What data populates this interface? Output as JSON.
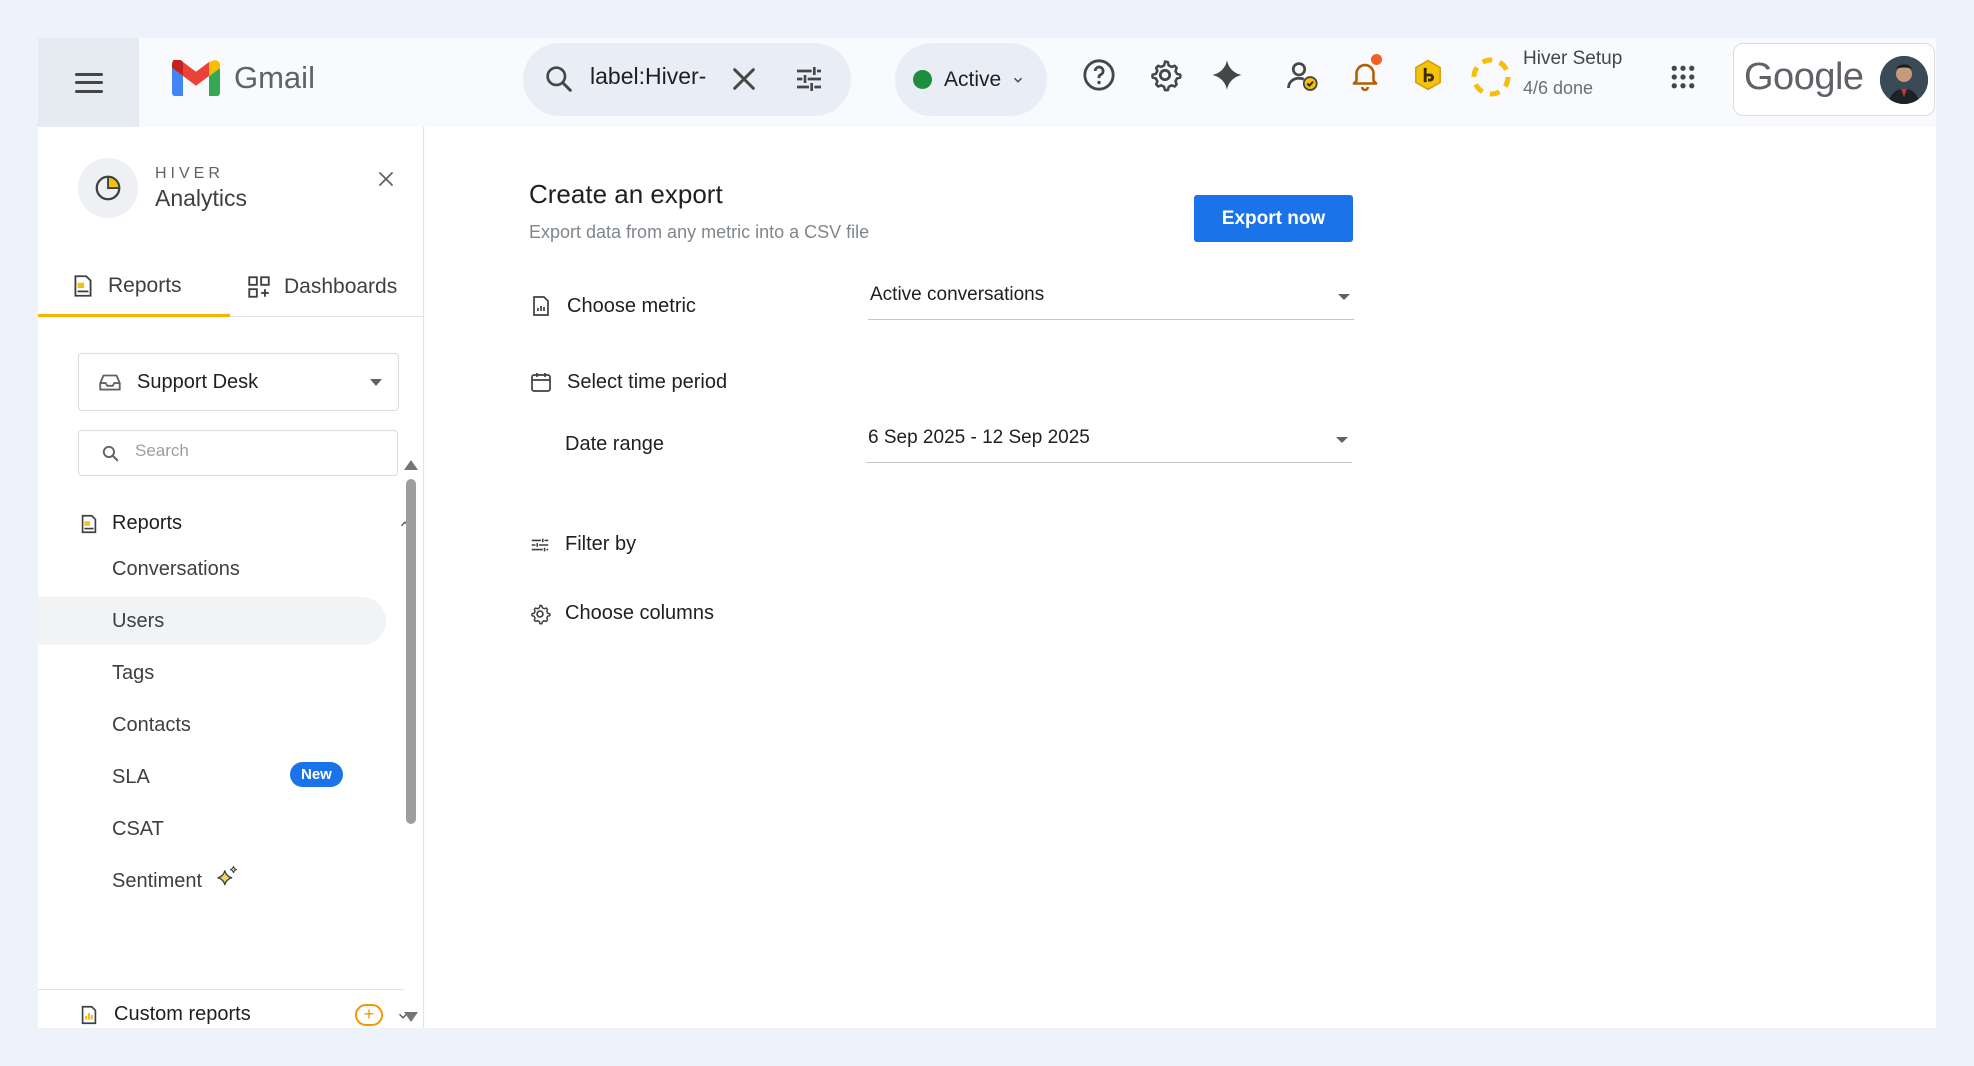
{
  "app": {
    "logo_text": "Gmail"
  },
  "search": {
    "query": "label:Hiver-"
  },
  "status": {
    "label": "Active",
    "color": "#1e8e3e"
  },
  "setup": {
    "title": "Hiver Setup",
    "progress": "4/6 done"
  },
  "account": {
    "brand": "Google"
  },
  "sidebar": {
    "brand": "HIVER",
    "title": "Analytics",
    "tabs": [
      {
        "label": "Reports",
        "active": true
      },
      {
        "label": "Dashboards",
        "active": false
      }
    ],
    "inbox_select": "Support Desk",
    "search_placeholder": "Search",
    "section_title": "Reports",
    "items": [
      {
        "label": "Conversations"
      },
      {
        "label": "Users",
        "selected": true
      },
      {
        "label": "Tags"
      },
      {
        "label": "Contacts"
      },
      {
        "label": "SLA",
        "badge": "New"
      },
      {
        "label": "CSAT"
      },
      {
        "label": "Sentiment"
      }
    ],
    "custom_reports": "Custom reports",
    "custom_add": "+"
  },
  "main": {
    "title": "Create an export",
    "subtitle": "Export data from any metric into a CSV file",
    "export_button": "Export now",
    "choose_metric_label": "Choose metric",
    "metric_value": "Active conversations",
    "time_period_label": "Select time period",
    "date_range_label": "Date range",
    "date_range_value": "6 Sep 2025 - 12 Sep 2025",
    "filter_label": "Filter by",
    "columns_label": "Choose columns"
  },
  "colors": {
    "accent": "#1a73e8",
    "hiver_yellow": "#f4b400"
  }
}
